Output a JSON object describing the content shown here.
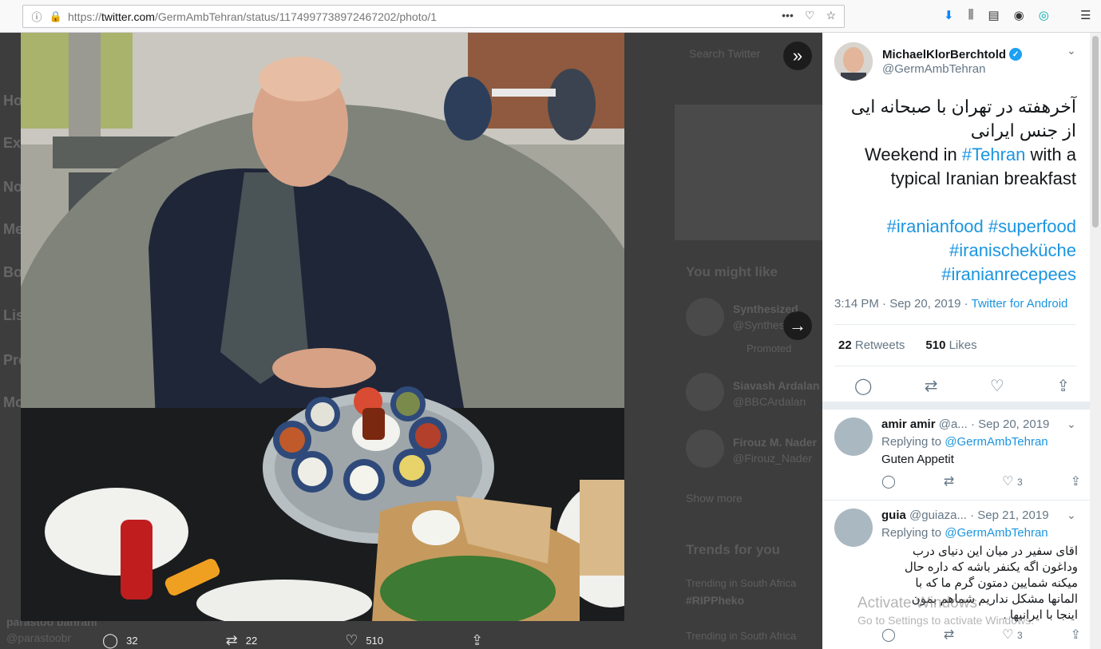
{
  "browser": {
    "url_prefix": "https://",
    "url_domain": "twitter.com",
    "url_path": "/GermAmbTehran/status/1174997738972467202/photo/1"
  },
  "background": {
    "nav_items": [
      "Ho",
      "Ex",
      "No",
      "Me",
      "Bo",
      "Lis",
      "Pro",
      "Mo"
    ],
    "search_placeholder": "Search Twitter",
    "you_might_like": "You might like",
    "suggestions": [
      {
        "name": "Synthesized",
        "handle": "@Synthes",
        "tag": "Promoted"
      },
      {
        "name": "Siavash Ardalan",
        "handle": "@BBCArdalan"
      },
      {
        "name": "Firouz M. Nader",
        "handle": "@Firouz_Nader"
      }
    ],
    "show_more": "Show more",
    "trends_title": "Trends for you",
    "trend_context": "Trending in South Africa",
    "trend_name": "#RIPPheko",
    "bottom_user": "parastoo bahrani",
    "bottom_handle": "@parastoobr"
  },
  "photo_actions": {
    "reply_count": "32",
    "retweet_count": "22",
    "like_count": "510"
  },
  "tweet": {
    "author_name": "MichaelKlorBerchtold",
    "author_handle": "@GermAmbTehran",
    "fa_line1": "آخرهفته در تهران با صبحانه ایی",
    "fa_line2": "از جنس ایرانی",
    "en_pre": "Weekend in ",
    "en_link": "#Tehran",
    "en_post": " with a",
    "en_line2": "typical Iranian breakfast",
    "hashtags": [
      "#iranianfood",
      "#superfood",
      "#iranischeküche",
      "#iranianrecepees"
    ],
    "time": "3:14 PM · Sep 20, 2019 · ",
    "source": "Twitter for Android",
    "retweets_count": "22",
    "retweets_label": "Retweets",
    "likes_count": "510",
    "likes_label": "Likes"
  },
  "replies": [
    {
      "name": "amir amir",
      "handle": "@a...",
      "date": "· Sep 20, 2019",
      "replying_prefix": "Replying to ",
      "replying_to": "@GermAmbTehran",
      "text": "Guten Appetit",
      "likes": "3"
    },
    {
      "name": "guia",
      "handle": "@guiaza...",
      "date": "· Sep 21, 2019",
      "replying_prefix": "Replying to ",
      "replying_to": "@GermAmbTehran",
      "text_lines": [
        "اقای سفیر در میان این دنیای درب",
        "وداغون اگه یکنفر باشه که  داره حال",
        "میکنه شمایین  دمتون گرم  ما که با",
        "المانها  مشکل نداریم  شماهم بمون",
        "اینجا  با ایرانیها ."
      ],
      "likes": "3"
    }
  ],
  "watermark": {
    "line1": "Activate Windows",
    "line2": "Go to Settings to activate Windows."
  }
}
